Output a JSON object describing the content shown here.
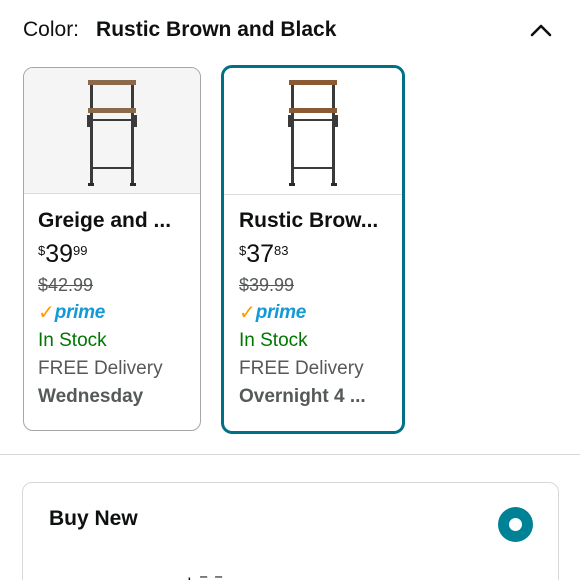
{
  "color_selector": {
    "label": "Color:",
    "selected_value": "Rustic Brown and Black",
    "collapse_icon": "chevron-up-icon"
  },
  "swatches": [
    {
      "title": "Greige and ...",
      "price_symbol": "$",
      "price_whole": "39",
      "price_fraction": "99",
      "list_price": "$42.99",
      "prime_check": "✓",
      "prime_word": "prime",
      "stock": "In Stock",
      "delivery": "FREE Delivery",
      "delivery_day": "Wednesday",
      "selected": false
    },
    {
      "title": "Rustic Brow...",
      "price_symbol": "$",
      "price_whole": "37",
      "price_fraction": "83",
      "list_price": "$39.99",
      "prime_check": "✓",
      "prime_word": "prime",
      "stock": "In Stock",
      "delivery": "FREE Delivery",
      "delivery_day": "Overnight 4 ...",
      "selected": true
    }
  ],
  "buy_options": {
    "title": "Buy New",
    "radio_selected": true,
    "partial_text": "| ‾ ‾"
  },
  "colors": {
    "accent": "#007185",
    "radio": "#008296",
    "in_stock": "#007600",
    "prime_blue": "#1399d6",
    "prime_check": "#ff9900",
    "muted_text": "#565959"
  }
}
